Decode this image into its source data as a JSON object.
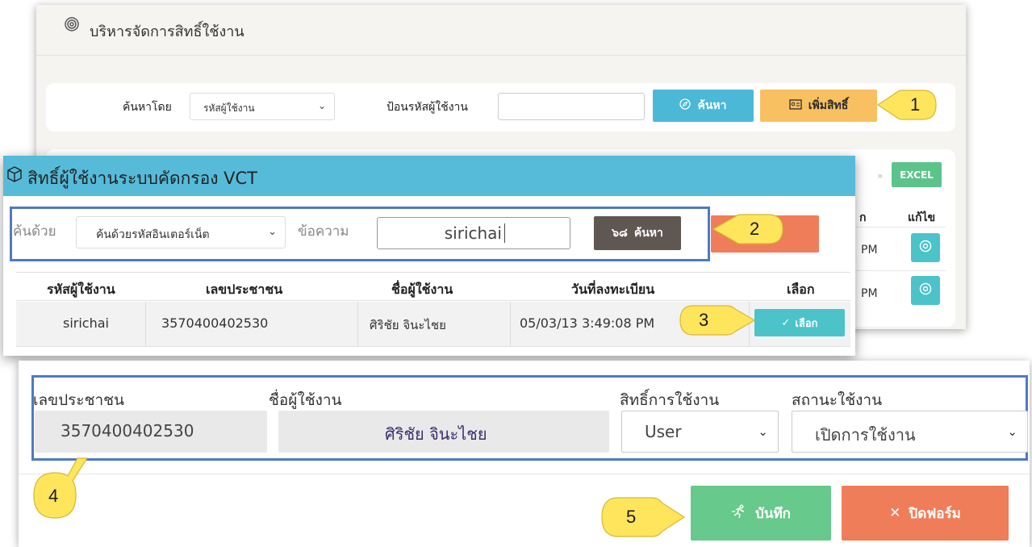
{
  "background_page": {
    "title": "บริหารจัดการสิทธิ์ใช้งาน",
    "title_icon": "fingerprint-icon",
    "search": {
      "searchby_label": "ค้นหาโดย",
      "searchby_value": "รหัสผู้ใช้งาน",
      "userid_label": "ป้อนรหัสผู้ใช้งาน",
      "userid_value": "",
      "search_button": "ค้นหา",
      "add_button": "เพิ่มสิทธิ์"
    },
    "results": {
      "pager_symbol": "»",
      "excel_button": "EXCEL",
      "partial_header": "ก",
      "edit_header": "แก้ไข",
      "row_times": [
        "PM",
        "PM"
      ]
    }
  },
  "dialog": {
    "title": "สิทธิ์ผู้ใช้งานระบบคัดกรอง VCT",
    "title_icon": "cube-icon",
    "searchby_label": "ค้นด้วย",
    "searchby_value": "ค้นด้วยรหัสอินเตอร์เน็ต",
    "text_label": "ข้อความ",
    "text_value": "sirichai",
    "search_button": "ค้นหา",
    "search_icon_glyph": "๖๘",
    "orange_button_partial": "ก",
    "table": {
      "headers": [
        "รหัสผู้ใช้งาน",
        "เลขประชาชน",
        "ชื่อผู้ใช้งาน",
        "วันที่ลงทะเบียน",
        "เลือก"
      ],
      "row": {
        "user_id": "sirichai",
        "citizen_id": "3570400402530",
        "name": "ศิริชัย จินะไชย",
        "registered": "05/03/13 3:49:08 PM",
        "select_button": "เลือก"
      }
    }
  },
  "form": {
    "citizen_id_label": "เลขประชาชน",
    "citizen_id_value": "3570400402530",
    "name_label": "ชื่อผู้ใช้งาน",
    "name_value": "ศิริชัย จินะไชย",
    "role_label": "สิทธิ์การใช้งาน",
    "role_value": "User",
    "status_label": "สถานะใช้งาน",
    "status_value": "เปิดการใช้งาน",
    "save_button": "บันทึก",
    "close_button": "ปิดฟอร์ม"
  },
  "callouts": [
    "1",
    "2",
    "3",
    "4",
    "5"
  ],
  "colors": {
    "accent_blue": "#56bbd9",
    "search_blue": "#4cb8d8",
    "add_yellow": "#f8c060",
    "teal": "#4cc3c9",
    "green": "#67c98b",
    "orange": "#f07d59",
    "frame_blue": "#4f79c5",
    "callout_yellow": "#ffe55c"
  }
}
